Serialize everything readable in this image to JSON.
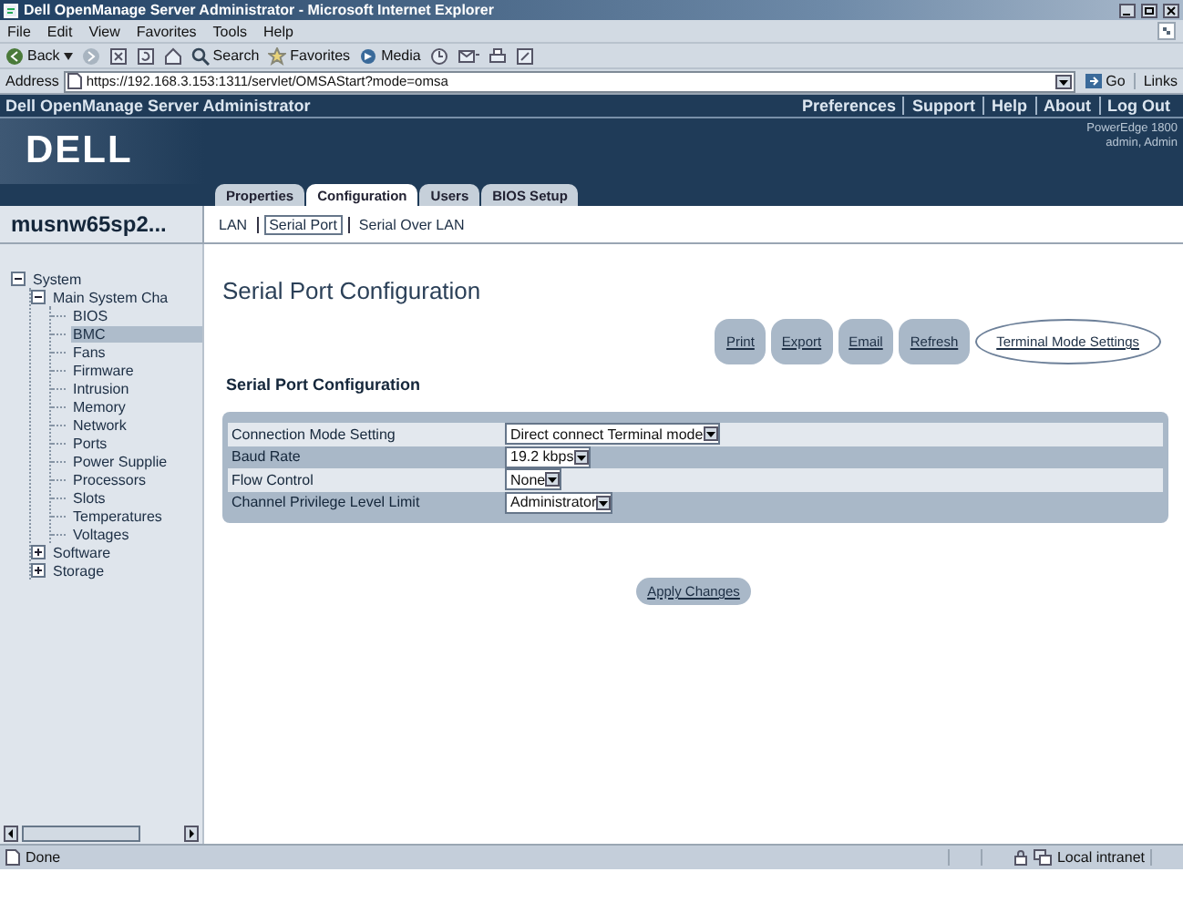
{
  "window": {
    "title": "Dell OpenManage Server Administrator - Microsoft Internet Explorer"
  },
  "menu": [
    "File",
    "Edit",
    "View",
    "Favorites",
    "Tools",
    "Help"
  ],
  "toolbar": [
    {
      "kind": "back",
      "label": "Back"
    },
    {
      "kind": "search",
      "label": "Search"
    },
    {
      "kind": "favorites",
      "label": "Favorites"
    },
    {
      "kind": "media",
      "label": "Media"
    }
  ],
  "address_bar": {
    "label": "Address",
    "url": "https://192.168.3.153:1311/servlet/OMSAStart?mode=omsa",
    "go": "Go",
    "links": "Links"
  },
  "app_header": {
    "title": "Dell OpenManage Server Administrator",
    "links": [
      "Preferences",
      "Support",
      "Help",
      "About",
      "Log Out"
    ]
  },
  "banner": {
    "logo": "DELL",
    "model": "PowerEdge 1800",
    "user": "admin, Admin"
  },
  "tabs": [
    {
      "label": "Properties",
      "selected": false
    },
    {
      "label": "Configuration",
      "selected": true
    },
    {
      "label": "Users",
      "selected": false
    },
    {
      "label": "BIOS Setup",
      "selected": false
    }
  ],
  "server_name": "musnw65sp2...",
  "subnav": [
    {
      "label": "LAN",
      "selected": false
    },
    {
      "label": "Serial Port",
      "selected": true
    },
    {
      "label": "Serial Over LAN",
      "selected": false
    }
  ],
  "tree": [
    {
      "label": "System",
      "expanded": true,
      "selected": false,
      "children": [
        {
          "label": "Main System Cha",
          "expanded": true,
          "selected": false,
          "children": [
            {
              "label": "BIOS",
              "selected": false
            },
            {
              "label": "BMC",
              "selected": true
            },
            {
              "label": "Fans",
              "selected": false
            },
            {
              "label": "Firmware",
              "selected": false
            },
            {
              "label": "Intrusion",
              "selected": false
            },
            {
              "label": "Memory",
              "selected": false
            },
            {
              "label": "Network",
              "selected": false
            },
            {
              "label": "Ports",
              "selected": false
            },
            {
              "label": "Power Supplie",
              "selected": false
            },
            {
              "label": "Processors",
              "selected": false
            },
            {
              "label": "Slots",
              "selected": false
            },
            {
              "label": "Temperatures",
              "selected": false
            },
            {
              "label": "Voltages",
              "selected": false
            }
          ]
        },
        {
          "label": "Software",
          "expanded": false,
          "selected": false
        },
        {
          "label": "Storage",
          "expanded": false,
          "selected": false
        }
      ]
    }
  ],
  "page_title": "Serial Port Configuration",
  "actions": [
    {
      "label": "Print",
      "circled": false
    },
    {
      "label": "Export",
      "circled": false
    },
    {
      "label": "Email",
      "circled": false
    },
    {
      "label": "Refresh",
      "circled": false
    },
    {
      "label": "Terminal Mode Settings",
      "circled": true
    }
  ],
  "section_title": "Serial Port Configuration",
  "settings": [
    {
      "label": "Connection Mode Setting",
      "value": "Direct connect Terminal mode"
    },
    {
      "label": "Baud Rate",
      "value": "19.2 kbps"
    },
    {
      "label": "Flow Control",
      "value": "None"
    },
    {
      "label": "Channel Privilege Level Limit",
      "value": "Administrator"
    }
  ],
  "apply_button": "Apply Changes",
  "status_bar": {
    "text": "Done",
    "zone": "Local intranet"
  }
}
